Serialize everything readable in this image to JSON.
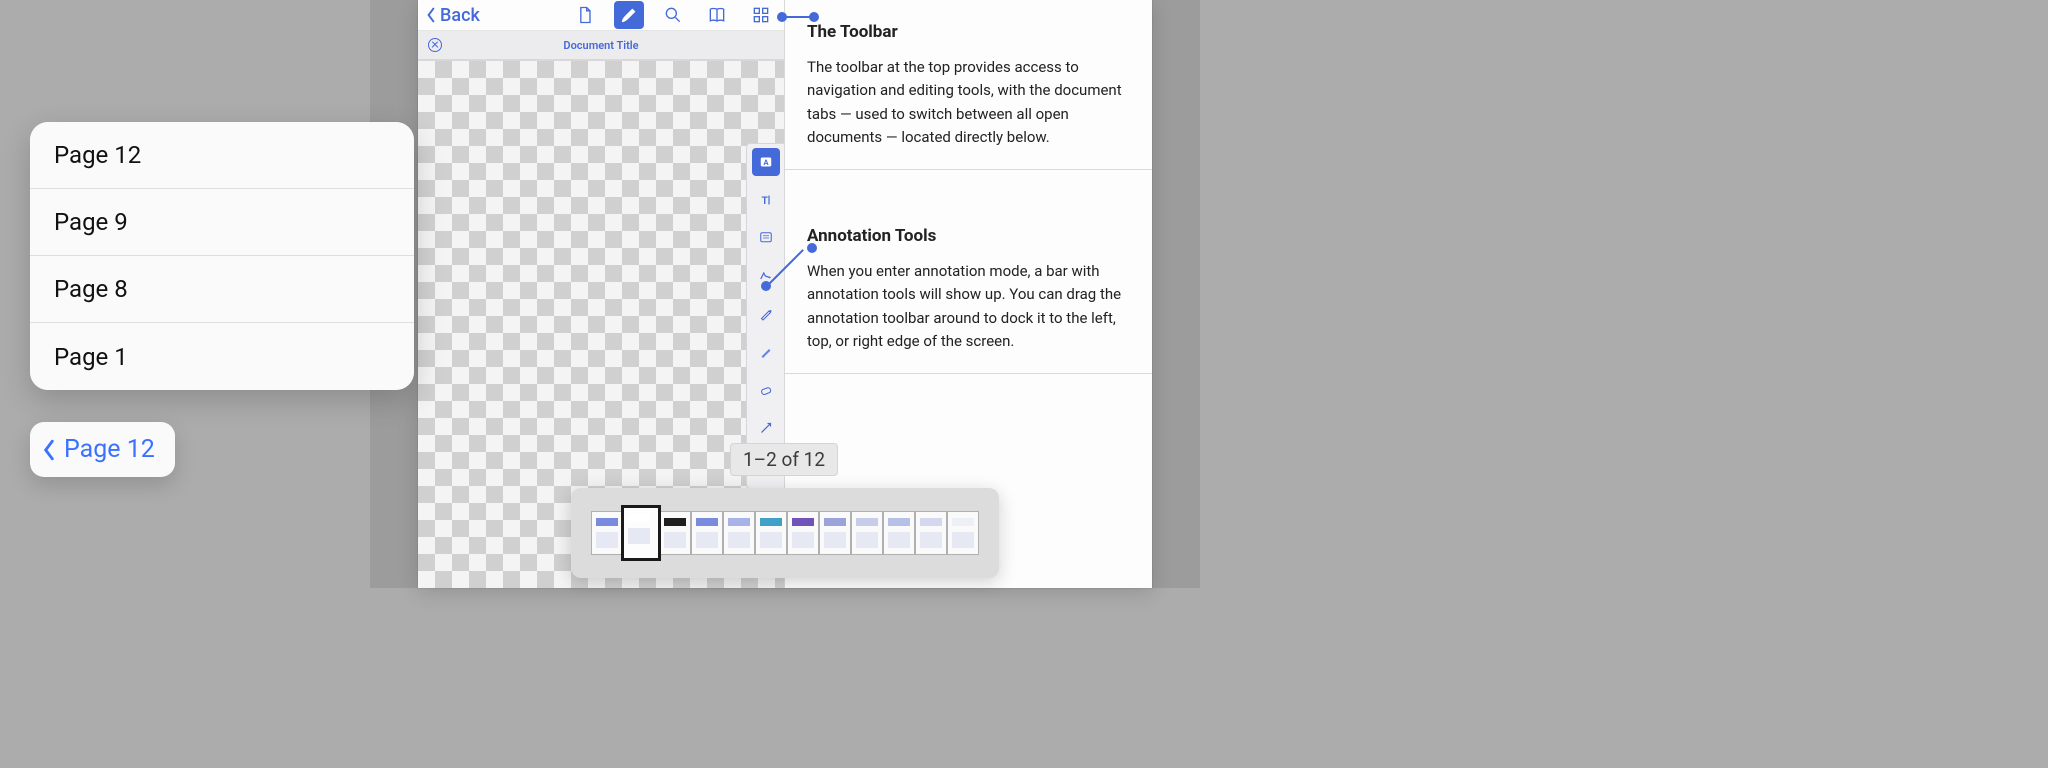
{
  "toolbar": {
    "back_label": "Back",
    "doc_tab_title": "Document Title"
  },
  "content": {
    "sections": [
      {
        "heading": "The Toolbar",
        "body": "The toolbar at the top provides access to navigation and editing tools, with the document tabs — used to switch between all open documents — located directly below."
      },
      {
        "heading": "Annotation Tools",
        "body": "When you enter annotation mode, a bar with annotation tools will show up. You can drag the annotation toolbar around to dock it to the left, top, or right edge of the screen."
      }
    ]
  },
  "page_counter": "1–2 of 12",
  "popover": {
    "items": [
      "Page 12",
      "Page 9",
      "Page 8",
      "Page 1"
    ]
  },
  "breadcrumb": {
    "label": "Page 12"
  },
  "thumbnails": {
    "count": 12,
    "current_index": 1
  }
}
